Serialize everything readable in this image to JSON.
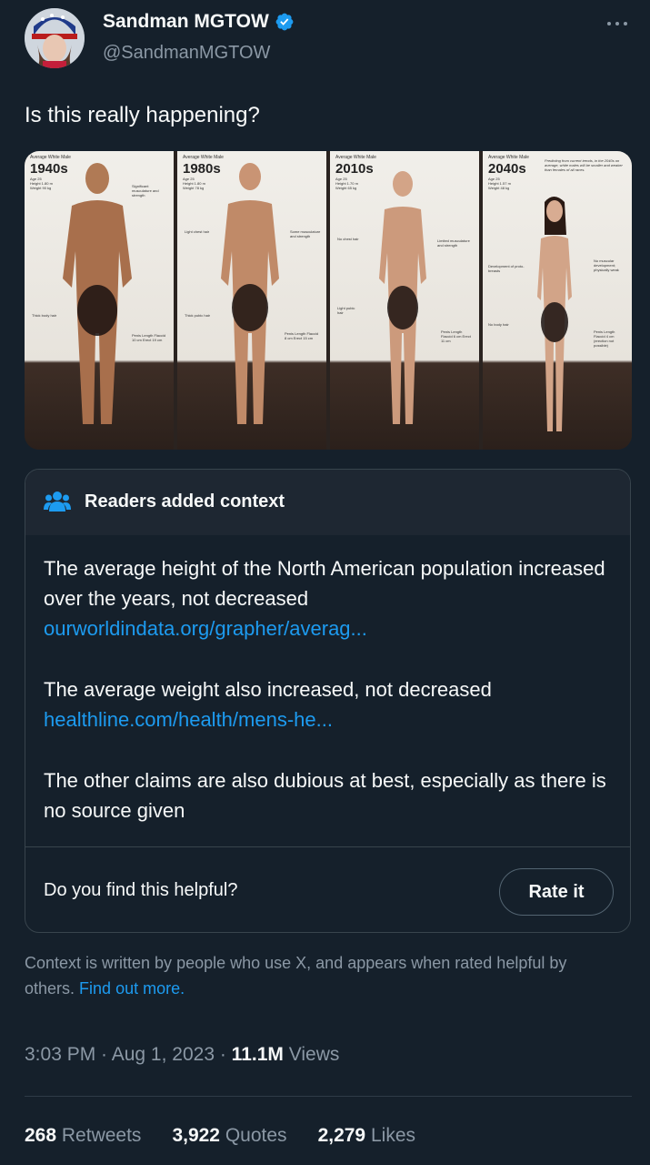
{
  "author": {
    "name": "Sandman MGTOW",
    "handle": "@SandmanMGTOW"
  },
  "tweet": {
    "text": "Is this really happening?"
  },
  "media": {
    "panels": [
      {
        "head": "Average White Male",
        "year": "1940s",
        "stats": [
          "Age 25",
          "Height 1.80 m",
          "Weight 90 kg"
        ],
        "note_a": "Significant musculature and strength",
        "note_b": "Thick body hair",
        "note_c": "Penis Length Flaccid 10 cm Erect 19 cm"
      },
      {
        "head": "Average White Male",
        "year": "1980s",
        "stats": [
          "Age 25",
          "Height 1.80 m",
          "Weight 78 kg"
        ],
        "note_a": "Some musculature and strength",
        "note_b": "Light chest hair",
        "note_c": "Thick pubic hair",
        "note_d": "Penis Length Flaccid 8 cm Erect 15 cm"
      },
      {
        "head": "Average White Male",
        "year": "2010s",
        "stats": [
          "Age 25",
          "Height 1.70 m",
          "Weight 65 kg"
        ],
        "note_a": "Limited musculature and strength",
        "note_b": "No chest hair",
        "note_c": "Light pubic hair",
        "note_d": "Penis Length Flaccid 6 cm Erect 11 cm"
      },
      {
        "head": "Average White Male",
        "year": "2040s",
        "stats": [
          "Age 25",
          "Height 1.57 m",
          "Weight 48 kg"
        ],
        "note_a": "Predicting from current trends, in the 2040s on average, white males will be smaller and weaker than females of all races.",
        "note_b": "Development of proto-breasts",
        "note_c": "No body hair",
        "note_d": "No muscular development; physically weak",
        "note_e": "Penis Length Flaccid 4 cm (erection not possible)"
      }
    ]
  },
  "note": {
    "title": "Readers added context",
    "p1_text": "The average height of the North American population increased over the years, not decreased",
    "p1_link": "ourworldindata.org/grapher/averag...",
    "p2_text": "The average weight also increased, not decreased",
    "p2_link": "healthline.com/health/mens-he...",
    "p3_text": "The other claims are also dubious at best, especially as there is no source given",
    "helpful_q": "Do you find this helpful?",
    "rate_label": "Rate it"
  },
  "context": {
    "text": "Context is written by people who use X, and appears when rated helpful by others.",
    "link": "Find out more."
  },
  "meta": {
    "time": "3:03 PM",
    "date": "Aug 1, 2023",
    "views_count": "11.1M",
    "views_label": "Views"
  },
  "stats": {
    "retweets_count": "268",
    "retweets_label": "Retweets",
    "quotes_count": "3,922",
    "quotes_label": "Quotes",
    "likes_count": "2,279",
    "likes_label": "Likes"
  },
  "colors": {
    "background": "#15202b",
    "accent": "#1d9bf0",
    "muted": "#8b98a5"
  }
}
